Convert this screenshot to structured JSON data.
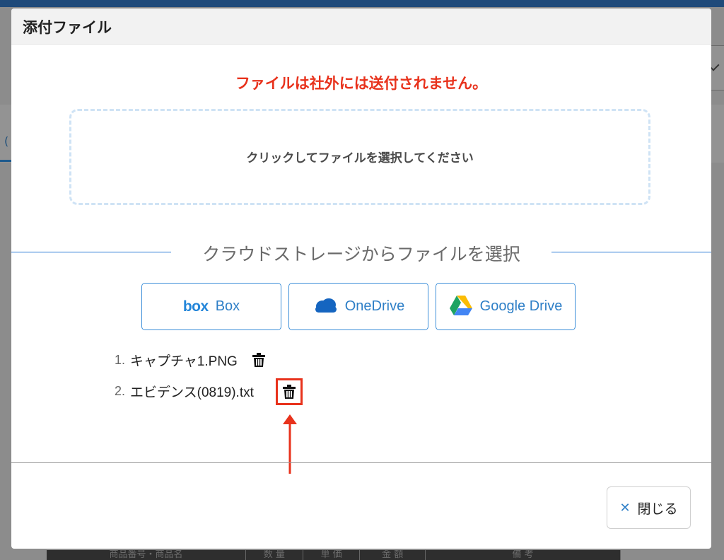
{
  "background": {
    "tab_char": "(",
    "table_headers": [
      "商品番号・商品名",
      "数 量",
      "単 価",
      "金 額",
      "備 考"
    ]
  },
  "modal": {
    "title": "添付ファイル",
    "notice": "ファイルは社外には送付されません。",
    "dropzone_text": "クリックしてファイルを選択してください",
    "cloud_heading": "クラウドストレージからファイルを選択",
    "cloud_buttons": [
      {
        "logo_text": "box",
        "label": "Box",
        "icon": "box-logo"
      },
      {
        "label": "OneDrive",
        "icon": "onedrive-cloud-icon"
      },
      {
        "label": "Google Drive",
        "icon": "google-drive-icon"
      }
    ],
    "files": [
      {
        "num": "1.",
        "name": "キャプチャ1.PNG",
        "icon": "trash-icon"
      },
      {
        "num": "2.",
        "name": "エビデンス(0819).txt",
        "icon": "trash-icon"
      }
    ],
    "close_label": "閉じる",
    "close_icon": "close-icon"
  },
  "colors": {
    "notice": "#e8321c",
    "accent": "#2e7fc7",
    "highlight": "#e8321c"
  }
}
